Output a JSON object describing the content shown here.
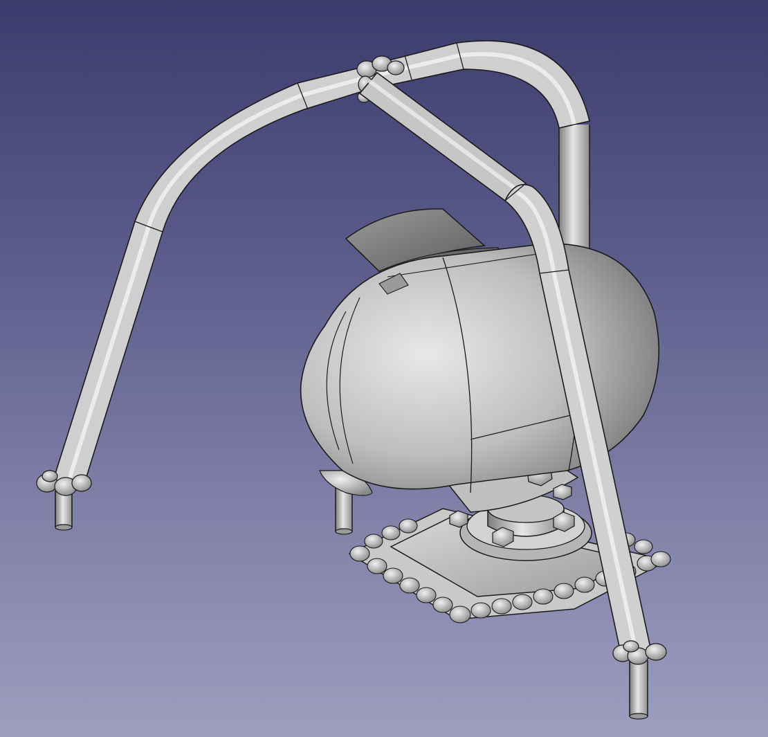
{
  "app": {
    "window_title": ""
  },
  "viewport": {
    "background_top": "#3b3b6c",
    "background_bottom": "#9d9dbf"
  },
  "model": {
    "parts": [
      {
        "id": "roll-bar-frame",
        "icon": "tube-frame"
      },
      {
        "id": "brace-tube",
        "icon": "tube"
      },
      {
        "id": "tank-body",
        "icon": "capsule"
      },
      {
        "id": "hatch",
        "icon": "wedge"
      },
      {
        "id": "pedestal-mount",
        "icon": "bracket"
      },
      {
        "id": "base-plate",
        "icon": "square-plate"
      },
      {
        "id": "bolt",
        "icon": "hex-bolt"
      },
      {
        "id": "foot-left",
        "icon": "post"
      },
      {
        "id": "foot-right",
        "icon": "post"
      },
      {
        "id": "foot-middle",
        "icon": "post"
      }
    ],
    "colors": {
      "surface_light": "#e6e6e6",
      "surface_mid": "#bdbdbd",
      "surface_dark": "#7a7a7a",
      "edge": "#1a1a1a"
    }
  }
}
